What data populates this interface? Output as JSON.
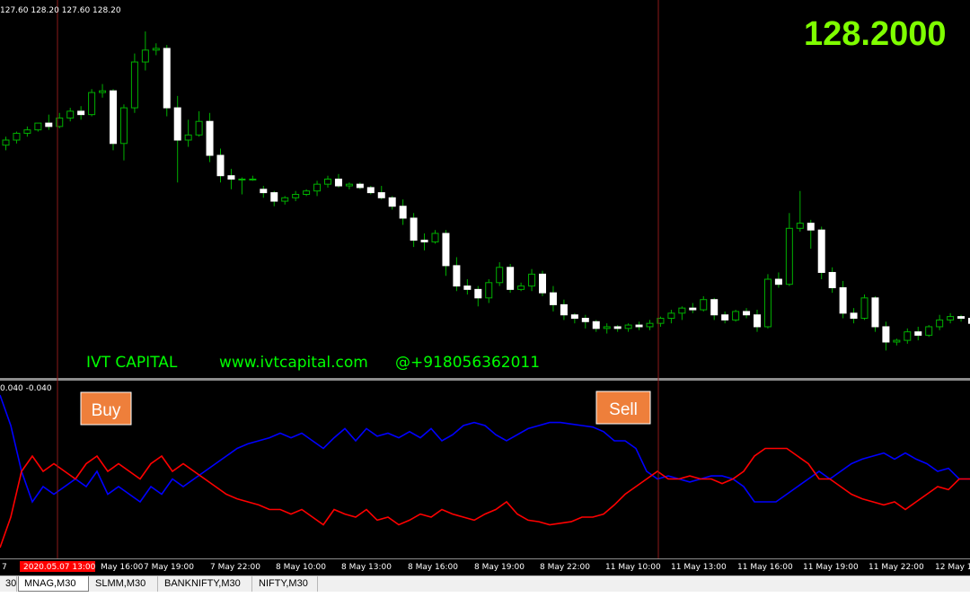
{
  "main_chart": {
    "ohlc_readout": "127.60 128.20 127.60 128.20",
    "current_price": "128.2000",
    "watermark": {
      "brand": "IVT CAPITAL",
      "website": "www.ivtcapital.com",
      "phone": "@+918056362011"
    },
    "candles": [
      [
        120.9,
        121.4,
        120.6,
        121.2
      ],
      [
        121.2,
        121.7,
        121.0,
        121.6
      ],
      [
        121.6,
        122.0,
        121.4,
        121.8
      ],
      [
        121.8,
        122.2,
        121.7,
        122.2
      ],
      [
        122.2,
        122.7,
        121.8,
        122.0
      ],
      [
        122.0,
        122.8,
        121.9,
        122.5
      ],
      [
        122.5,
        123.1,
        122.3,
        122.9
      ],
      [
        122.9,
        123.2,
        122.4,
        122.7
      ],
      [
        122.7,
        124.2,
        122.6,
        124.0
      ],
      [
        124.0,
        124.5,
        123.7,
        124.1
      ],
      [
        124.1,
        124.2,
        120.6,
        121.0
      ],
      [
        121.0,
        123.3,
        120.0,
        123.1
      ],
      [
        123.1,
        126.3,
        122.8,
        125.8
      ],
      [
        125.8,
        127.6,
        125.3,
        126.5
      ],
      [
        126.5,
        126.9,
        126.2,
        126.6
      ],
      [
        126.6,
        126.8,
        122.6,
        123.1
      ],
      [
        123.1,
        123.8,
        118.7,
        121.2
      ],
      [
        121.2,
        122.4,
        120.8,
        121.5
      ],
      [
        121.5,
        122.9,
        121.4,
        122.3
      ],
      [
        122.3,
        122.8,
        119.9,
        120.3
      ],
      [
        120.3,
        120.7,
        118.7,
        119.1
      ],
      [
        119.1,
        119.5,
        118.3,
        118.9
      ],
      [
        118.9,
        119.0,
        118.0,
        118.9
      ],
      [
        118.9,
        119.1,
        118.8,
        118.9
      ],
      [
        118.3,
        118.5,
        117.8,
        118.1
      ],
      [
        118.1,
        118.2,
        117.3,
        117.6
      ],
      [
        117.6,
        117.9,
        117.4,
        117.8
      ],
      [
        117.8,
        118.2,
        117.6,
        118.0
      ],
      [
        118.0,
        118.3,
        117.9,
        118.2
      ],
      [
        118.2,
        118.8,
        117.9,
        118.6
      ],
      [
        118.6,
        119.1,
        118.4,
        118.9
      ],
      [
        118.9,
        119.2,
        118.4,
        118.5
      ],
      [
        118.5,
        118.7,
        118.3,
        118.6
      ],
      [
        118.6,
        118.7,
        118.3,
        118.4
      ],
      [
        118.4,
        118.5,
        118.0,
        118.1
      ],
      [
        118.1,
        118.5,
        117.7,
        117.8
      ],
      [
        117.8,
        117.9,
        117.1,
        117.3
      ],
      [
        117.3,
        117.7,
        116.2,
        116.6
      ],
      [
        116.6,
        116.9,
        114.9,
        115.3
      ],
      [
        115.3,
        115.7,
        114.7,
        115.2
      ],
      [
        115.2,
        115.9,
        115.1,
        115.7
      ],
      [
        115.7,
        115.9,
        113.2,
        113.8
      ],
      [
        113.8,
        114.3,
        112.3,
        112.6
      ],
      [
        112.6,
        113.0,
        112.1,
        112.4
      ],
      [
        112.4,
        112.6,
        111.4,
        111.9
      ],
      [
        111.9,
        113.0,
        111.6,
        112.8
      ],
      [
        112.8,
        114.0,
        112.6,
        113.7
      ],
      [
        113.7,
        113.9,
        112.2,
        112.4
      ],
      [
        112.4,
        112.8,
        112.3,
        112.6
      ],
      [
        112.6,
        113.6,
        112.3,
        113.3
      ],
      [
        113.3,
        113.5,
        112.0,
        112.2
      ],
      [
        112.2,
        112.6,
        111.1,
        111.5
      ],
      [
        111.5,
        111.8,
        110.6,
        110.9
      ],
      [
        110.9,
        111.0,
        110.4,
        110.7
      ],
      [
        110.7,
        110.9,
        110.1,
        110.5
      ],
      [
        110.5,
        110.6,
        109.9,
        110.1
      ],
      [
        110.1,
        110.4,
        109.8,
        110.2
      ],
      [
        110.2,
        110.3,
        109.9,
        110.1
      ],
      [
        110.1,
        110.4,
        109.9,
        110.3
      ],
      [
        110.3,
        110.5,
        110.0,
        110.2
      ],
      [
        110.2,
        110.6,
        110.0,
        110.4
      ],
      [
        110.4,
        110.8,
        110.2,
        110.7
      ],
      [
        110.7,
        111.2,
        110.4,
        111.0
      ],
      [
        111.0,
        111.4,
        110.6,
        111.3
      ],
      [
        111.3,
        111.6,
        111.0,
        111.2
      ],
      [
        111.2,
        112.0,
        111.1,
        111.8
      ],
      [
        111.8,
        111.9,
        110.6,
        110.9
      ],
      [
        110.9,
        111.1,
        110.4,
        110.6
      ],
      [
        110.6,
        111.2,
        110.5,
        111.1
      ],
      [
        111.1,
        111.3,
        110.7,
        110.9
      ],
      [
        110.9,
        111.2,
        109.9,
        110.2
      ],
      [
        110.2,
        113.3,
        110.1,
        113.0
      ],
      [
        113.0,
        113.4,
        112.5,
        112.7
      ],
      [
        112.7,
        116.9,
        112.6,
        116.0
      ],
      [
        116.0,
        118.2,
        115.8,
        116.3
      ],
      [
        116.3,
        116.5,
        114.8,
        115.9
      ],
      [
        115.9,
        116.1,
        113.0,
        113.4
      ],
      [
        113.4,
        113.7,
        112.2,
        112.5
      ],
      [
        112.5,
        112.9,
        110.7,
        111.0
      ],
      [
        111.0,
        111.3,
        110.4,
        110.7
      ],
      [
        110.7,
        112.1,
        110.6,
        111.9
      ],
      [
        111.9,
        112.0,
        109.9,
        110.2
      ],
      [
        110.2,
        110.5,
        108.8,
        109.3
      ],
      [
        109.3,
        109.5,
        109.1,
        109.4
      ],
      [
        109.4,
        110.1,
        109.2,
        109.9
      ],
      [
        109.9,
        110.2,
        109.4,
        109.7
      ],
      [
        109.7,
        110.3,
        109.6,
        110.2
      ],
      [
        110.2,
        110.9,
        110.0,
        110.6
      ],
      [
        110.6,
        111.0,
        110.4,
        110.8
      ],
      [
        110.8,
        110.9,
        110.5,
        110.7
      ],
      [
        110.7,
        111.0,
        110.1,
        110.4
      ]
    ],
    "buy_marker": "Buy",
    "sell_marker": "Sell"
  },
  "indicator": {
    "readout": "0.040 -0.040",
    "blue_line": [
      0.05,
      0.03,
      0.0,
      -0.02,
      -0.01,
      -0.015,
      -0.01,
      -0.005,
      -0.01,
      0.0,
      -0.015,
      -0.01,
      -0.015,
      -0.02,
      -0.01,
      -0.015,
      -0.005,
      -0.01,
      -0.005,
      0.0,
      0.005,
      0.01,
      0.015,
      0.018,
      0.02,
      0.022,
      0.025,
      0.022,
      0.025,
      0.02,
      0.015,
      0.022,
      0.028,
      0.02,
      0.028,
      0.023,
      0.025,
      0.022,
      0.026,
      0.022,
      0.028,
      0.02,
      0.024,
      0.03,
      0.032,
      0.03,
      0.024,
      0.02,
      0.024,
      0.028,
      0.03,
      0.032,
      0.032,
      0.031,
      0.03,
      0.029,
      0.026,
      0.02,
      0.02,
      0.015,
      0.0,
      -0.005,
      -0.003,
      -0.005,
      -0.007,
      -0.005,
      -0.003,
      -0.003,
      -0.005,
      -0.01,
      -0.02,
      -0.02,
      -0.02,
      -0.015,
      -0.01,
      -0.005,
      0.0,
      -0.005,
      0.0,
      0.005,
      0.008,
      0.01,
      0.012,
      0.008,
      0.012,
      0.008,
      0.005,
      0.0,
      0.002,
      -0.005,
      -0.005
    ],
    "red_line": [
      -0.05,
      -0.03,
      0.0,
      0.01,
      0.0,
      0.005,
      0.0,
      -0.005,
      0.005,
      0.01,
      0.0,
      0.005,
      0.0,
      -0.005,
      0.005,
      0.01,
      0.0,
      0.005,
      0.0,
      -0.005,
      -0.01,
      -0.015,
      -0.018,
      -0.02,
      -0.022,
      -0.025,
      -0.025,
      -0.028,
      -0.025,
      -0.03,
      -0.035,
      -0.025,
      -0.028,
      -0.03,
      -0.025,
      -0.032,
      -0.03,
      -0.035,
      -0.032,
      -0.028,
      -0.03,
      -0.025,
      -0.028,
      -0.03,
      -0.032,
      -0.028,
      -0.025,
      -0.02,
      -0.028,
      -0.032,
      -0.033,
      -0.035,
      -0.034,
      -0.033,
      -0.03,
      -0.03,
      -0.028,
      -0.022,
      -0.015,
      -0.01,
      -0.005,
      0.0,
      -0.005,
      -0.005,
      -0.003,
      -0.005,
      -0.005,
      -0.008,
      -0.005,
      0.0,
      0.01,
      0.015,
      0.015,
      0.015,
      0.01,
      0.005,
      -0.005,
      -0.005,
      -0.01,
      -0.015,
      -0.018,
      -0.02,
      -0.022,
      -0.02,
      -0.025,
      -0.02,
      -0.015,
      -0.01,
      -0.012,
      -0.005,
      -0.005
    ]
  },
  "time_axis": {
    "highlighted_label": "2020.05.07 13:00",
    "labels": [
      "7",
      "May 16:00",
      "7 May 19:00",
      "7 May 22:00",
      "8 May 10:00",
      "8 May 13:00",
      "8 May 16:00",
      "8 May 19:00",
      "8 May 22:00",
      "11 May 10:00",
      "11 May 13:00",
      "11 May 16:00",
      "11 May 19:00",
      "11 May 22:00",
      "12 May 1"
    ]
  },
  "tabs": [
    {
      "label": "30"
    },
    {
      "label": "MNAG,M30",
      "active": true
    },
    {
      "label": "SLMM,M30"
    },
    {
      "label": "BANKNIFTY,M30"
    },
    {
      "label": "NIFTY,M30"
    }
  ],
  "colors": {
    "background": "#000000",
    "bull_candle": "#00b000",
    "bear_candle": "#ffffff",
    "price": "#7fff00",
    "watermark": "#00ff00",
    "blue_line": "#0000ff",
    "red_line": "#ff0000",
    "marker_bg": "#ee7f3b",
    "vline": "#8b1a1a"
  }
}
